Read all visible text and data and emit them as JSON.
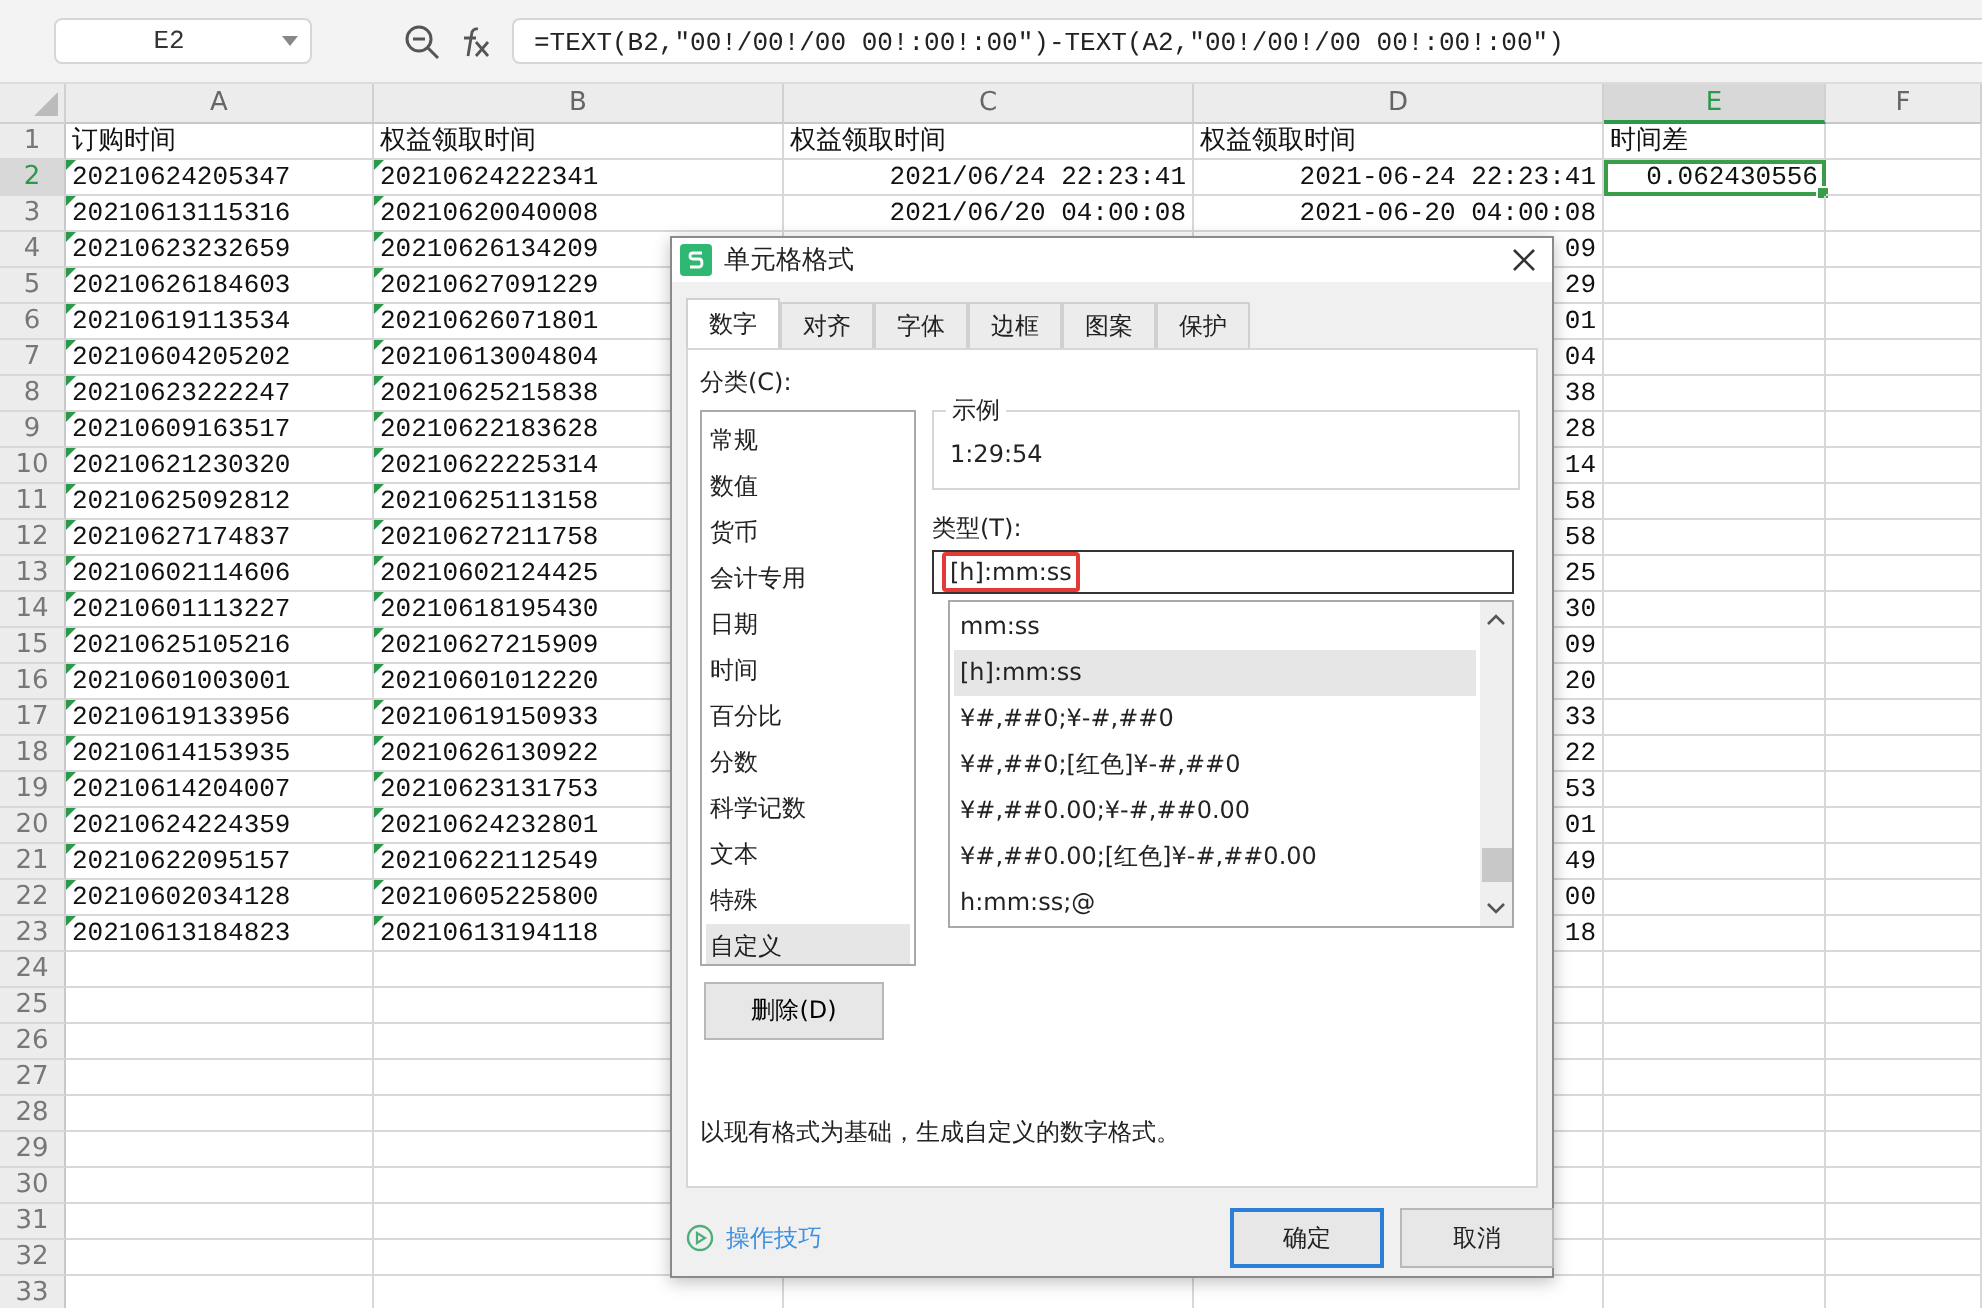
{
  "name_box": {
    "value": "E2"
  },
  "formula_bar": {
    "value": "=TEXT(B2,\"00!/00!/00 00!:00!:00\")-TEXT(A2,\"00!/00!/00 00!:00!:00\")"
  },
  "columns": [
    {
      "label": "A",
      "selected": false
    },
    {
      "label": "B",
      "selected": false
    },
    {
      "label": "C",
      "selected": false
    },
    {
      "label": "D",
      "selected": false
    },
    {
      "label": "E",
      "selected": true
    },
    {
      "label": "F",
      "selected": false
    }
  ],
  "rows": [
    {
      "number": "1",
      "selected": false,
      "cells": [
        {
          "text": "订购时间",
          "kind": "label",
          "selected": false
        },
        {
          "text": "权益领取时间",
          "kind": "label",
          "selected": false
        },
        {
          "text": "权益领取时间",
          "kind": "label",
          "selected": false
        },
        {
          "text": "权益领取时间",
          "kind": "label",
          "selected": false
        },
        {
          "text": "时间差",
          "kind": "label",
          "selected": false
        },
        null
      ]
    },
    {
      "number": "2",
      "selected": true,
      "cells": [
        {
          "text": "20210624205347",
          "kind": "text_number",
          "selected": false
        },
        {
          "text": "20210624222341",
          "kind": "text_number",
          "selected": false
        },
        {
          "text": "2021/06/24 22:23:41",
          "kind": "number",
          "selected": false
        },
        {
          "text": "2021-06-24 22:23:41",
          "kind": "number",
          "selected": false
        },
        {
          "text": "0.062430556",
          "kind": "number",
          "selected": true
        },
        null
      ]
    },
    {
      "number": "3",
      "selected": false,
      "cells": [
        {
          "text": "20210613115316",
          "kind": "text_number",
          "selected": false
        },
        {
          "text": "20210620040008",
          "kind": "text_number",
          "selected": false
        },
        {
          "text": "2021/06/20 04:00:08",
          "kind": "number",
          "selected": false
        },
        {
          "text": "2021-06-20 04:00:08",
          "kind": "number",
          "selected": false
        },
        null,
        null
      ]
    },
    {
      "number": "4",
      "selected": false,
      "cells": [
        {
          "text": "20210623232659",
          "kind": "text_number",
          "selected": false
        },
        {
          "text": "20210626134209",
          "kind": "text_number",
          "selected": false
        },
        null,
        {
          "text": "09",
          "kind": "number",
          "selected": false
        },
        null,
        null
      ]
    },
    {
      "number": "5",
      "selected": false,
      "cells": [
        {
          "text": "20210626184603",
          "kind": "text_number",
          "selected": false
        },
        {
          "text": "20210627091229",
          "kind": "text_number",
          "selected": false
        },
        null,
        {
          "text": "29",
          "kind": "number",
          "selected": false
        },
        null,
        null
      ]
    },
    {
      "number": "6",
      "selected": false,
      "cells": [
        {
          "text": "20210619113534",
          "kind": "text_number",
          "selected": false
        },
        {
          "text": "20210626071801",
          "kind": "text_number",
          "selected": false
        },
        null,
        {
          "text": "01",
          "kind": "number",
          "selected": false
        },
        null,
        null
      ]
    },
    {
      "number": "7",
      "selected": false,
      "cells": [
        {
          "text": "20210604205202",
          "kind": "text_number",
          "selected": false
        },
        {
          "text": "20210613004804",
          "kind": "text_number",
          "selected": false
        },
        null,
        {
          "text": "04",
          "kind": "number",
          "selected": false
        },
        null,
        null
      ]
    },
    {
      "number": "8",
      "selected": false,
      "cells": [
        {
          "text": "20210623222247",
          "kind": "text_number",
          "selected": false
        },
        {
          "text": "20210625215838",
          "kind": "text_number",
          "selected": false
        },
        null,
        {
          "text": "38",
          "kind": "number",
          "selected": false
        },
        null,
        null
      ]
    },
    {
      "number": "9",
      "selected": false,
      "cells": [
        {
          "text": "20210609163517",
          "kind": "text_number",
          "selected": false
        },
        {
          "text": "20210622183628",
          "kind": "text_number",
          "selected": false
        },
        null,
        {
          "text": "28",
          "kind": "number",
          "selected": false
        },
        null,
        null
      ]
    },
    {
      "number": "10",
      "selected": false,
      "cells": [
        {
          "text": "20210621230320",
          "kind": "text_number",
          "selected": false
        },
        {
          "text": "20210622225314",
          "kind": "text_number",
          "selected": false
        },
        null,
        {
          "text": "14",
          "kind": "number",
          "selected": false
        },
        null,
        null
      ]
    },
    {
      "number": "11",
      "selected": false,
      "cells": [
        {
          "text": "20210625092812",
          "kind": "text_number",
          "selected": false
        },
        {
          "text": "20210625113158",
          "kind": "text_number",
          "selected": false
        },
        null,
        {
          "text": "58",
          "kind": "number",
          "selected": false
        },
        null,
        null
      ]
    },
    {
      "number": "12",
      "selected": false,
      "cells": [
        {
          "text": "20210627174837",
          "kind": "text_number",
          "selected": false
        },
        {
          "text": "20210627211758",
          "kind": "text_number",
          "selected": false
        },
        null,
        {
          "text": "58",
          "kind": "number",
          "selected": false
        },
        null,
        null
      ]
    },
    {
      "number": "13",
      "selected": false,
      "cells": [
        {
          "text": "20210602114606",
          "kind": "text_number",
          "selected": false
        },
        {
          "text": "20210602124425",
          "kind": "text_number",
          "selected": false
        },
        null,
        {
          "text": "25",
          "kind": "number",
          "selected": false
        },
        null,
        null
      ]
    },
    {
      "number": "14",
      "selected": false,
      "cells": [
        {
          "text": "20210601113227",
          "kind": "text_number",
          "selected": false
        },
        {
          "text": "20210618195430",
          "kind": "text_number",
          "selected": false
        },
        null,
        {
          "text": "30",
          "kind": "number",
          "selected": false
        },
        null,
        null
      ]
    },
    {
      "number": "15",
      "selected": false,
      "cells": [
        {
          "text": "20210625105216",
          "kind": "text_number",
          "selected": false
        },
        {
          "text": "20210627215909",
          "kind": "text_number",
          "selected": false
        },
        null,
        {
          "text": "09",
          "kind": "number",
          "selected": false
        },
        null,
        null
      ]
    },
    {
      "number": "16",
      "selected": false,
      "cells": [
        {
          "text": "20210601003001",
          "kind": "text_number",
          "selected": false
        },
        {
          "text": "20210601012220",
          "kind": "text_number",
          "selected": false
        },
        null,
        {
          "text": "20",
          "kind": "number",
          "selected": false
        },
        null,
        null
      ]
    },
    {
      "number": "17",
      "selected": false,
      "cells": [
        {
          "text": "20210619133956",
          "kind": "text_number",
          "selected": false
        },
        {
          "text": "20210619150933",
          "kind": "text_number",
          "selected": false
        },
        null,
        {
          "text": "33",
          "kind": "number",
          "selected": false
        },
        null,
        null
      ]
    },
    {
      "number": "18",
      "selected": false,
      "cells": [
        {
          "text": "20210614153935",
          "kind": "text_number",
          "selected": false
        },
        {
          "text": "20210626130922",
          "kind": "text_number",
          "selected": false
        },
        null,
        {
          "text": "22",
          "kind": "number",
          "selected": false
        },
        null,
        null
      ]
    },
    {
      "number": "19",
      "selected": false,
      "cells": [
        {
          "text": "20210614204007",
          "kind": "text_number",
          "selected": false
        },
        {
          "text": "20210623131753",
          "kind": "text_number",
          "selected": false
        },
        null,
        {
          "text": "53",
          "kind": "number",
          "selected": false
        },
        null,
        null
      ]
    },
    {
      "number": "20",
      "selected": false,
      "cells": [
        {
          "text": "20210624224359",
          "kind": "text_number",
          "selected": false
        },
        {
          "text": "20210624232801",
          "kind": "text_number",
          "selected": false
        },
        null,
        {
          "text": "01",
          "kind": "number",
          "selected": false
        },
        null,
        null
      ]
    },
    {
      "number": "21",
      "selected": false,
      "cells": [
        {
          "text": "20210622095157",
          "kind": "text_number",
          "selected": false
        },
        {
          "text": "20210622112549",
          "kind": "text_number",
          "selected": false
        },
        null,
        {
          "text": "49",
          "kind": "number",
          "selected": false
        },
        null,
        null
      ]
    },
    {
      "number": "22",
      "selected": false,
      "cells": [
        {
          "text": "20210602034128",
          "kind": "text_number",
          "selected": false
        },
        {
          "text": "20210605225800",
          "kind": "text_number",
          "selected": false
        },
        null,
        {
          "text": "00",
          "kind": "number",
          "selected": false
        },
        null,
        null
      ]
    },
    {
      "number": "23",
      "selected": false,
      "cells": [
        {
          "text": "20210613184823",
          "kind": "text_number",
          "selected": false
        },
        {
          "text": "20210613194118",
          "kind": "text_number",
          "selected": false
        },
        null,
        {
          "text": "18",
          "kind": "number",
          "selected": false
        },
        null,
        null
      ]
    },
    {
      "number": "24",
      "selected": false
    },
    {
      "number": "25",
      "selected": false
    },
    {
      "number": "26",
      "selected": false
    },
    {
      "number": "27",
      "selected": false
    },
    {
      "number": "28",
      "selected": false
    },
    {
      "number": "29",
      "selected": false
    },
    {
      "number": "30",
      "selected": false
    },
    {
      "number": "31",
      "selected": false
    },
    {
      "number": "32",
      "selected": false
    },
    {
      "number": "33",
      "selected": false
    }
  ],
  "dialog": {
    "title": "单元格格式",
    "tabs": [
      {
        "label": "数字",
        "selected": true
      },
      {
        "label": "对齐",
        "selected": false
      },
      {
        "label": "字体",
        "selected": false
      },
      {
        "label": "边框",
        "selected": false
      },
      {
        "label": "图案",
        "selected": false
      },
      {
        "label": "保护",
        "selected": false
      }
    ],
    "category_label": "分类(C):",
    "categories": [
      {
        "label": "常规",
        "selected": false
      },
      {
        "label": "数值",
        "selected": false
      },
      {
        "label": "货币",
        "selected": false
      },
      {
        "label": "会计专用",
        "selected": false
      },
      {
        "label": "日期",
        "selected": false
      },
      {
        "label": "时间",
        "selected": false
      },
      {
        "label": "百分比",
        "selected": false
      },
      {
        "label": "分数",
        "selected": false
      },
      {
        "label": "科学记数",
        "selected": false
      },
      {
        "label": "文本",
        "selected": false
      },
      {
        "label": "特殊",
        "selected": false
      },
      {
        "label": "自定义",
        "selected": true
      }
    ],
    "sample": {
      "label": "示例",
      "value": "1:29:54"
    },
    "type_label": "类型(T):",
    "type_field": {
      "value": "[h]:mm:ss",
      "highlighted": true
    },
    "formats": [
      {
        "label": "mm:ss",
        "selected": false
      },
      {
        "label": "[h]:mm:ss",
        "selected": true
      },
      {
        "label": "¥#,##0;¥-#,##0",
        "selected": false
      },
      {
        "label": "¥#,##0;[红色]¥-#,##0",
        "selected": false
      },
      {
        "label": "¥#,##0.00;¥-#,##0.00",
        "selected": false
      },
      {
        "label": "¥#,##0.00;[红色]¥-#,##0.00",
        "selected": false
      },
      {
        "label": "h:mm:ss;@",
        "selected": false
      }
    ],
    "delete_button": "删除(D)",
    "description": "以现有格式为基础，生成自定义的数字格式。",
    "tips_link": "操作技巧",
    "buttons": [
      {
        "label": "确定",
        "kind": "primary"
      },
      {
        "label": "取消",
        "kind": "normal"
      }
    ]
  }
}
